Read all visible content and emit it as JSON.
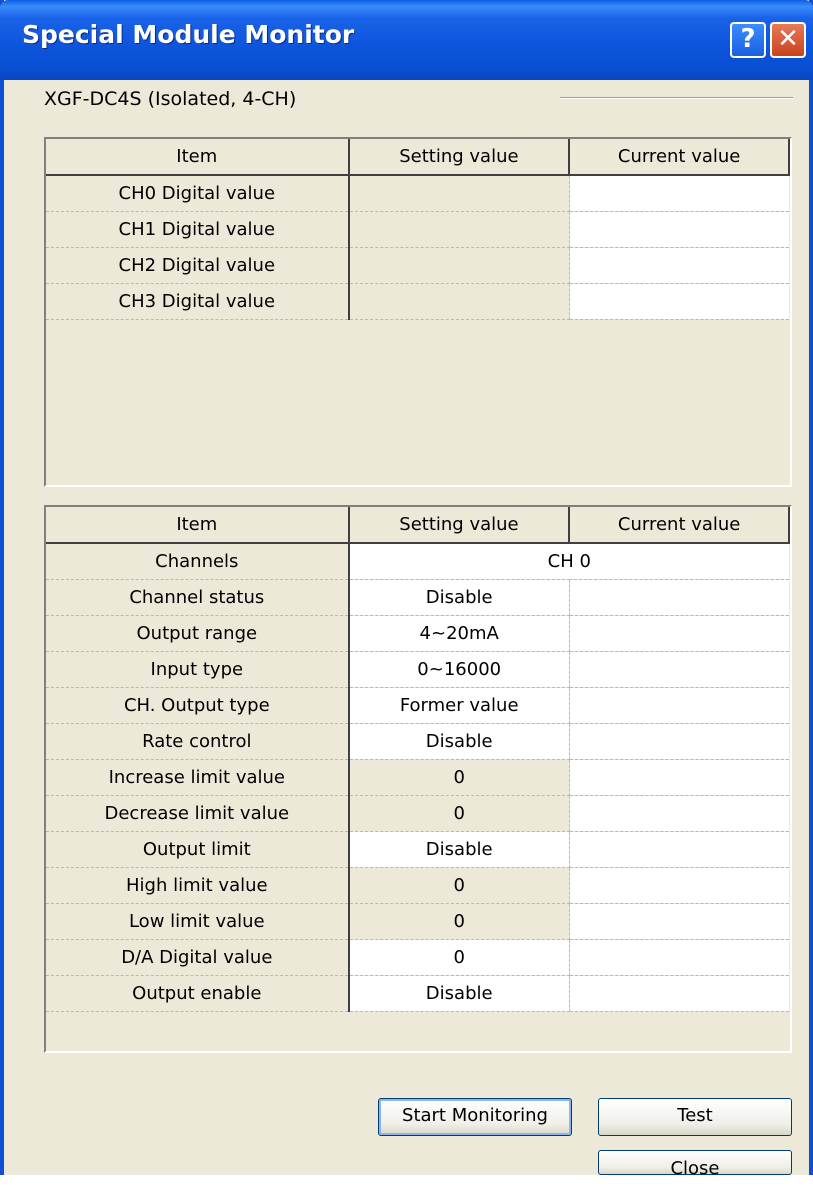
{
  "window": {
    "title": "Special Module Monitor",
    "help_glyph": "?",
    "close_glyph": "✕",
    "title_color": "#0a4fd3"
  },
  "module": {
    "name": "XGF-DC4S (Isolated, 4-CH)"
  },
  "digital_table": {
    "headers": [
      "Item",
      "Setting value",
      "Current value"
    ],
    "rows": [
      {
        "item": "CH0 Digital value",
        "setting": "",
        "current": ""
      },
      {
        "item": "CH1 Digital value",
        "setting": "",
        "current": ""
      },
      {
        "item": "CH2 Digital value",
        "setting": "",
        "current": ""
      },
      {
        "item": "CH3 Digital value",
        "setting": "",
        "current": ""
      }
    ]
  },
  "param_table": {
    "headers": [
      "Item",
      "Setting value",
      "Current value"
    ],
    "channels": {
      "item": "Channels",
      "value": "CH 0"
    },
    "rows": [
      {
        "item": "Channel status",
        "setting": "Disable",
        "current": "",
        "editable": true
      },
      {
        "item": "Output range",
        "setting": "4~20mA",
        "current": "",
        "editable": true
      },
      {
        "item": "Input type",
        "setting": "0~16000",
        "current": "",
        "editable": true
      },
      {
        "item": "CH. Output type",
        "setting": "Former value",
        "current": "",
        "editable": true
      },
      {
        "item": "Rate control",
        "setting": "Disable",
        "current": "",
        "editable": true
      },
      {
        "item": "Increase limit value",
        "setting": "0",
        "current": "",
        "editable": false
      },
      {
        "item": "Decrease limit value",
        "setting": "0",
        "current": "",
        "editable": false
      },
      {
        "item": "Output limit",
        "setting": "Disable",
        "current": "",
        "editable": true
      },
      {
        "item": "High limit value",
        "setting": "0",
        "current": "",
        "editable": false
      },
      {
        "item": "Low limit value",
        "setting": "0",
        "current": "",
        "editable": false
      },
      {
        "item": "D/A Digital value",
        "setting": "0",
        "current": "",
        "editable": true
      },
      {
        "item": "Output enable",
        "setting": "Disable",
        "current": "",
        "editable": true
      }
    ]
  },
  "buttons": {
    "start_monitoring": "Start Monitoring",
    "test": "Test",
    "close": "Close"
  }
}
